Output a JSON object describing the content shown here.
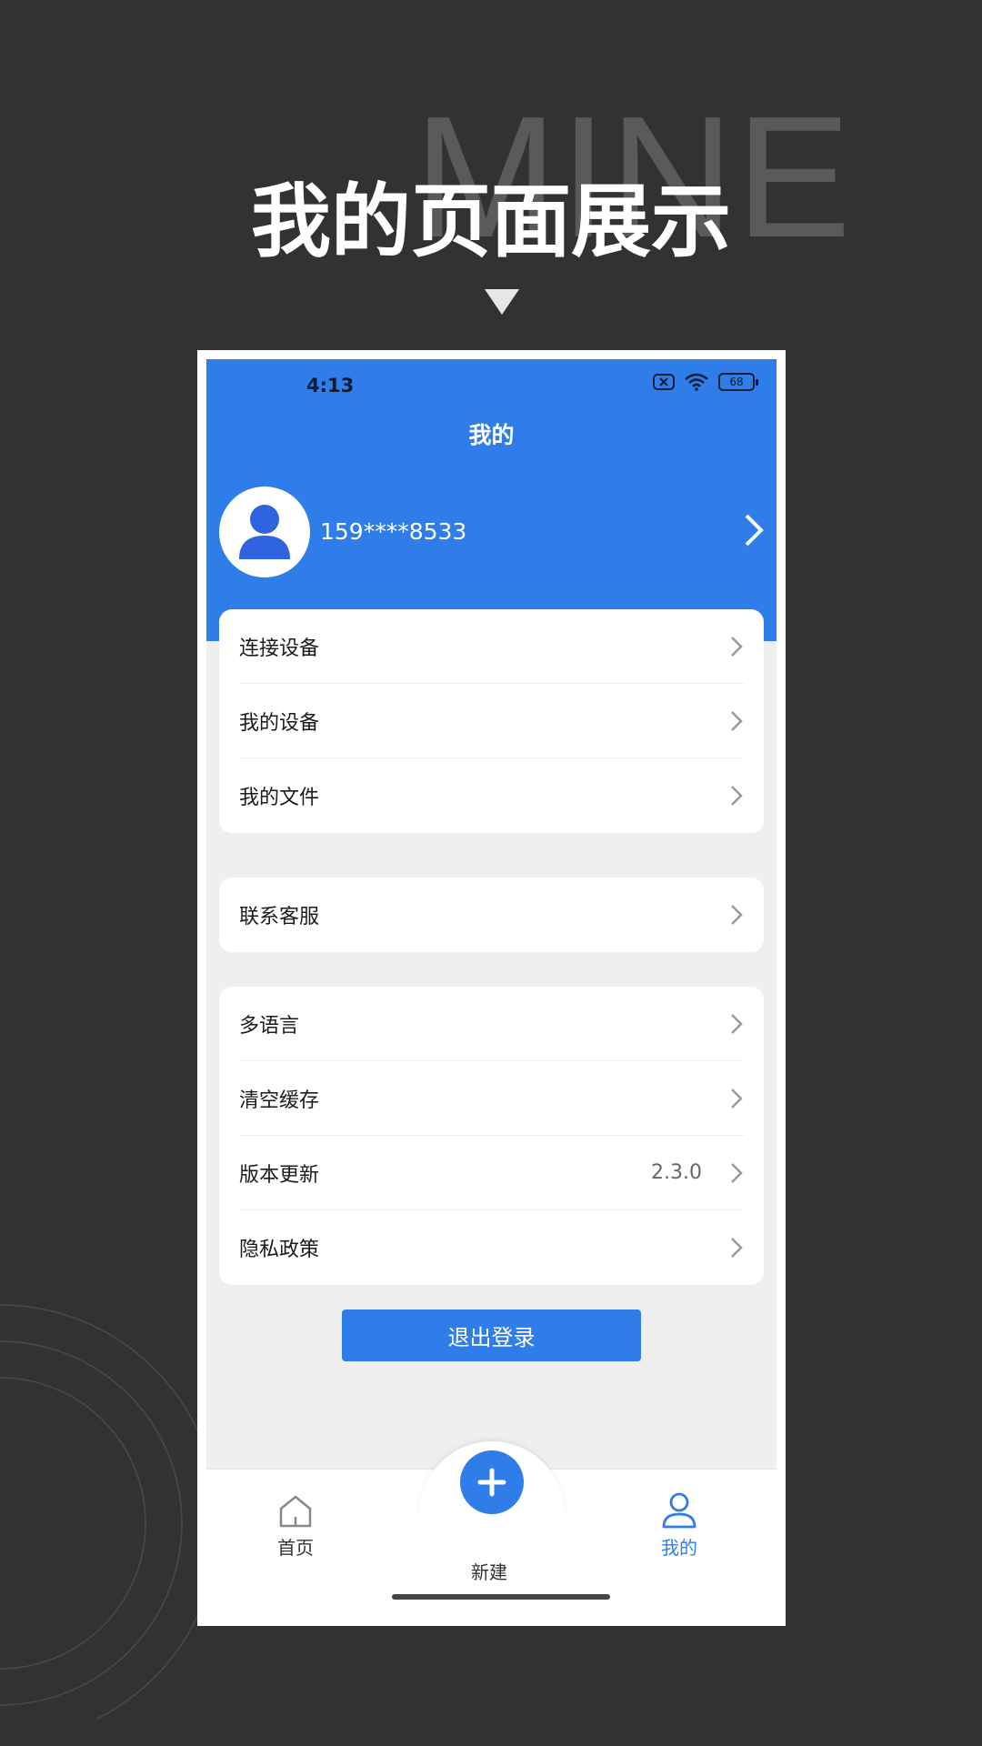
{
  "banner": {
    "watermark": "MINE",
    "headline": "我的页面展示"
  },
  "status_bar": {
    "time": "4:13",
    "battery": "68"
  },
  "header": {
    "title": "我的"
  },
  "profile": {
    "phone": "159****8533"
  },
  "menu_group_1": [
    {
      "label": "连接设备"
    },
    {
      "label": "我的设备"
    },
    {
      "label": "我的文件"
    }
  ],
  "menu_group_2": [
    {
      "label": "联系客服"
    }
  ],
  "menu_group_3": [
    {
      "label": "多语言"
    },
    {
      "label": "清空缓存"
    },
    {
      "label": "版本更新",
      "value": "2.3.0"
    },
    {
      "label": "隐私政策"
    }
  ],
  "logout_label": "退出登录",
  "tabbar": {
    "home": "首页",
    "create": "新建",
    "mine": "我的"
  },
  "colors": {
    "accent": "#2f7de8",
    "background": "#323232"
  }
}
